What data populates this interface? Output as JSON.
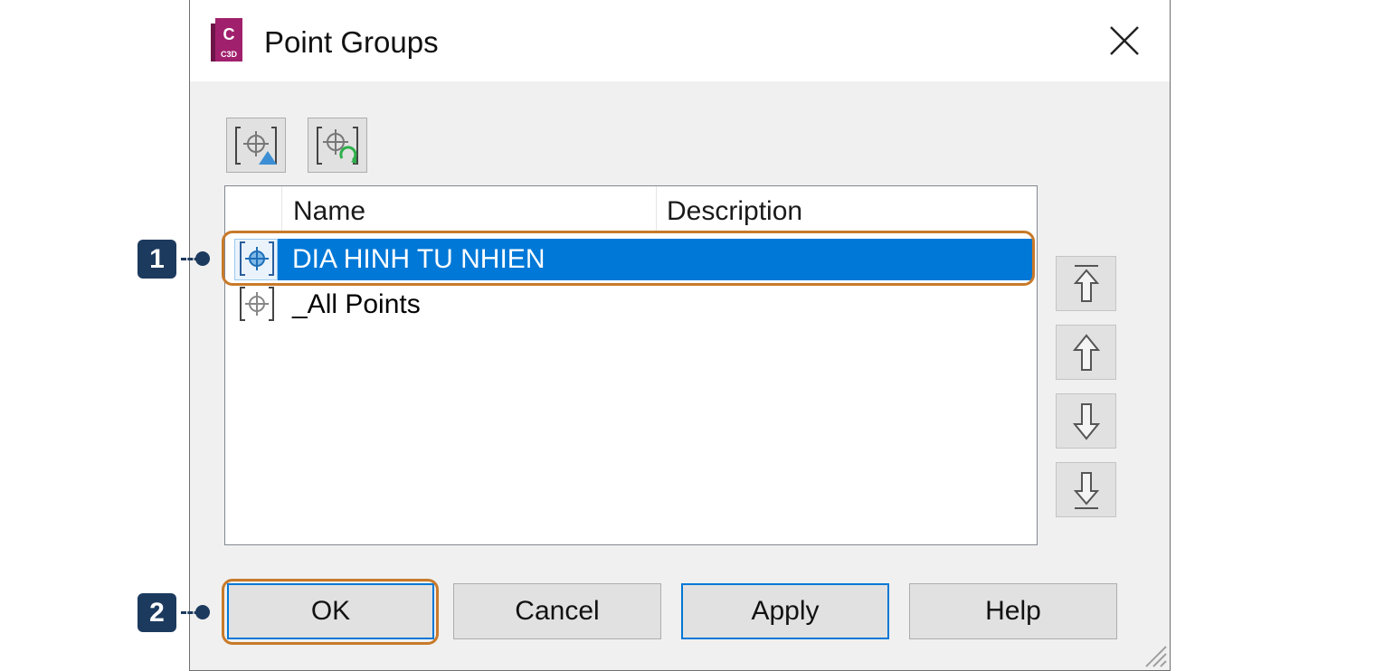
{
  "window": {
    "title": "Point Groups",
    "app_icon": {
      "letter": "C",
      "caption": "C3D",
      "color": "#a1206d"
    }
  },
  "toolbar": {
    "buttons": [
      {
        "name": "point-group-properties-icon"
      },
      {
        "name": "update-point-groups-icon"
      }
    ]
  },
  "list": {
    "columns": [
      "Name",
      "Description"
    ],
    "rows": [
      {
        "name": "DIA HINH TU NHIEN",
        "description": "",
        "selected": true
      },
      {
        "name": "_All Points",
        "description": "",
        "selected": false
      }
    ]
  },
  "move_buttons": [
    {
      "name": "move-to-top-icon"
    },
    {
      "name": "move-up-icon"
    },
    {
      "name": "move-down-icon"
    },
    {
      "name": "move-to-bottom-icon"
    }
  ],
  "buttons": {
    "ok": "OK",
    "cancel": "Cancel",
    "apply": "Apply",
    "help": "Help"
  },
  "callouts": [
    "1",
    "2"
  ],
  "colors": {
    "selection": "#0078d7",
    "callout_border": "#c87a2a",
    "callout_badge": "#1c3a5e"
  }
}
